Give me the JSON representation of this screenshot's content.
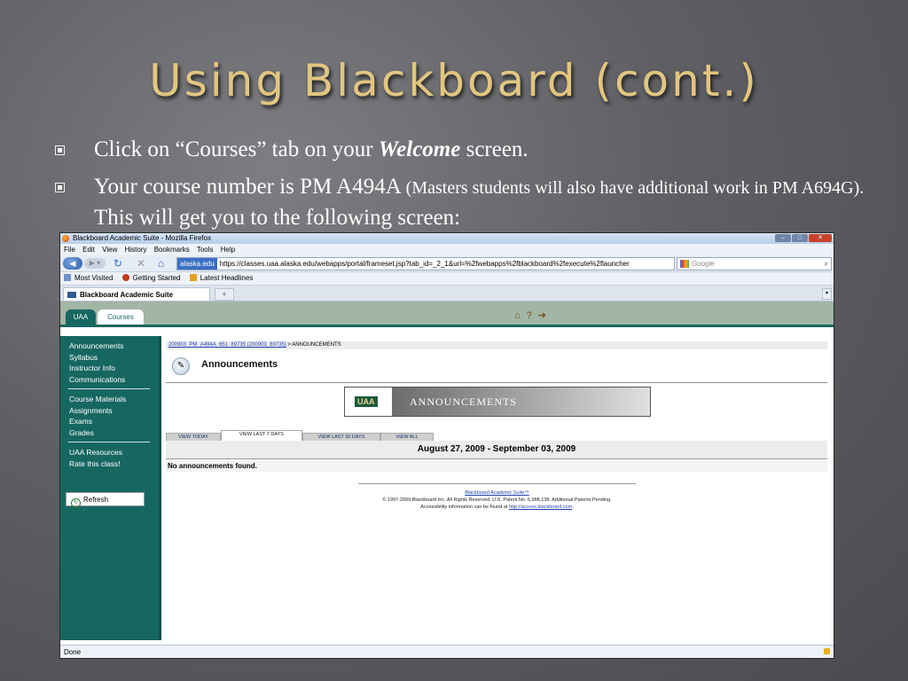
{
  "slide": {
    "title": "Using Blackboard (cont.)",
    "bullet1_pre": "Click on “Courses” tab on your ",
    "bullet1_em": "Welcome",
    "bullet1_post": " screen.",
    "bullet2_main": "Your course number is PM A494A ",
    "bullet2_small": "(Masters students will also have additional work in PM A694G).",
    "bullet2_end": " This will get you to the following screen:"
  },
  "browser": {
    "window_title": "Blackboard Academic Suite - Mozilla Firefox",
    "menu": [
      "File",
      "Edit",
      "View",
      "History",
      "Bookmarks",
      "Tools",
      "Help"
    ],
    "site_badge": "alaska.edu",
    "url": "https://classes.uaa.alaska.edu/webapps/portal/frameset.jsp?tab_id=_2_1&url=%2fwebapps%2fblackboard%2fexecute%2flauncher",
    "search_placeholder": "Google",
    "bookmarks": [
      "Most Visited",
      "Getting Started",
      "Latest Headlines"
    ],
    "tab_label": "Blackboard Academic Suite",
    "new_tab": "+",
    "status": "Done"
  },
  "bb": {
    "tabs": [
      "UAA",
      "Courses"
    ],
    "sidebar_group1": [
      "Announcements",
      "Syllabus",
      "Instructor Info",
      "Communications"
    ],
    "sidebar_group2": [
      "Course Materials",
      "Assignments",
      "Exams",
      "Grades"
    ],
    "sidebar_group3": [
      "UAA Resources",
      "Rate this class!"
    ],
    "refresh_label": "Refresh",
    "breadcrumb_link": "200903_PM_A494A_651_89735 (200903_89735)",
    "breadcrumb_current": " > ANNOUNCEMENTS",
    "page_heading": "Announcements",
    "banner_logo": "UAA",
    "banner_title": "ANNOUNCEMENTS",
    "view_tabs": [
      "VIEW TODAY",
      "VIEW LAST 7 DAYS",
      "VIEW LAST 30 DAYS",
      "VIEW ALL"
    ],
    "date_range": "August 27, 2009 - September 03, 2009",
    "no_announcements": "No announcements found.",
    "footer_title": "Blackboard Academic Suite™",
    "footer_line1": "© 1997-2009 Blackboard Inc. All Rights Reserved. U.S. Patent No. 6,988,138. Additional Patents Pending.",
    "footer_line2_pre": "Accessibility information can be found at ",
    "footer_link": "http://access.blackboard.com",
    "footer_line2_post": "."
  }
}
